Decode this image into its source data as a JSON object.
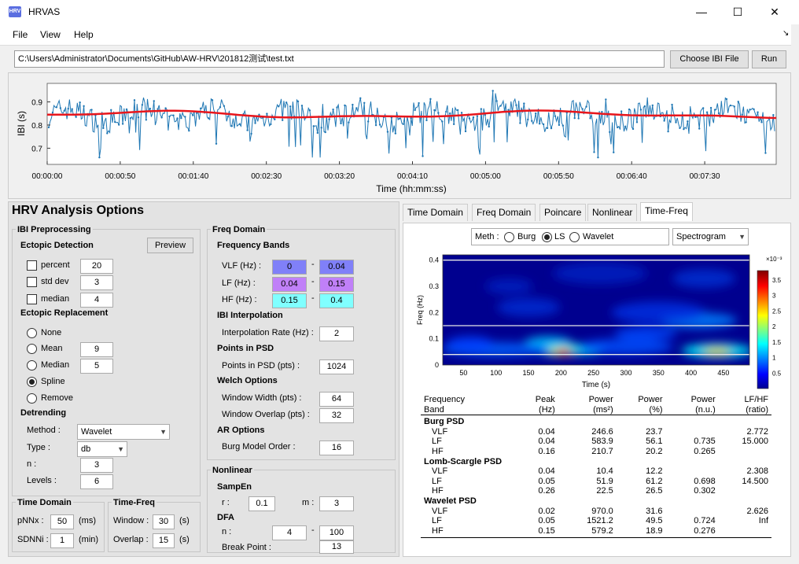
{
  "window": {
    "title": "HRVAS",
    "icon_text": "HRV",
    "minimize": "—",
    "maximize": "☐",
    "close": "✕"
  },
  "menu": {
    "file": "File",
    "view": "View",
    "help": "Help",
    "corner": "↘"
  },
  "file_path": "C:\\Users\\Administrator\\Documents\\GitHub\\AW-HRV\\201812测试\\test.txt",
  "buttons": {
    "choose": "Choose IBI File",
    "run": "Run",
    "preview": "Preview"
  },
  "ibi_plot": {
    "ylabel": "IBI (s)",
    "xlabel": "Time (hh:mm:ss)",
    "yticks": [
      "0.9",
      "0.8",
      "0.7"
    ],
    "xticks": [
      "00:00:00",
      "00:00:50",
      "00:01:40",
      "00:02:30",
      "00:03:20",
      "00:04:10",
      "00:05:00",
      "00:05:50",
      "00:06:40",
      "00:07:30"
    ],
    "colors": {
      "ibi": "#1f77b4",
      "trend": "#e8161c"
    }
  },
  "options": {
    "title": "HRV Analysis Options",
    "ibi_pre": "IBI Preprocessing",
    "ectopic_detection": "Ectopic Detection",
    "percent": {
      "label": "percent",
      "value": "20"
    },
    "stddev": {
      "label": "std dev",
      "value": "3"
    },
    "median": {
      "label": "median",
      "value": "4"
    },
    "ectopic_replacement": "Ectopic Replacement",
    "rep_none": "None",
    "rep_mean": {
      "label": "Mean",
      "value": "9"
    },
    "rep_median": {
      "label": "Median",
      "value": "5"
    },
    "rep_spline": "Spline",
    "rep_remove": "Remove",
    "detrending": "Detrending",
    "method": {
      "label": "Method :",
      "value": "Wavelet"
    },
    "type": {
      "label": "Type :",
      "value": "db"
    },
    "n": {
      "label": "n :",
      "value": "3"
    },
    "levels": {
      "label": "Levels :",
      "value": "6"
    },
    "time_domain": "Time Domain",
    "pnnx": {
      "label": "pNNx :",
      "value": "50",
      "unit": "(ms)"
    },
    "sdnni": {
      "label": "SDNNi :",
      "value": "1",
      "unit": "(min)"
    },
    "time_freq": "Time-Freq",
    "window": {
      "label": "Window :",
      "value": "30",
      "unit": "(s)"
    },
    "overlap": {
      "label": "Overlap :",
      "value": "15",
      "unit": "(s)"
    },
    "freq_domain": "Freq Domain",
    "freq_bands": "Frequency Bands",
    "vlf": {
      "label": "VLF (Hz) :",
      "lo": "0",
      "hi": "0.04"
    },
    "lf": {
      "label": "LF (Hz) :",
      "lo": "0.04",
      "hi": "0.15"
    },
    "hf": {
      "label": "HF (Hz) :",
      "lo": "0.15",
      "hi": "0.4"
    },
    "dash": "-",
    "ibi_interp": "IBI Interpolation",
    "interp_rate": {
      "label": "Interpolation Rate (Hz) :",
      "value": "2"
    },
    "points_psd": "Points in PSD",
    "points_psd_pts": {
      "label": "Points in PSD (pts) :",
      "value": "1024"
    },
    "welch": "Welch Options",
    "window_width": {
      "label": "Window Width (pts) :",
      "value": "64"
    },
    "window_overlap": {
      "label": "Window Overlap (pts) :",
      "value": "32"
    },
    "ar": "AR Options",
    "burg_order": {
      "label": "Burg Model Order :",
      "value": "16"
    },
    "nonlinear": "Nonlinear",
    "sampen": "SampEn",
    "r": {
      "label": "r :",
      "value": "0.1"
    },
    "m": {
      "label": "m :",
      "value": "3"
    },
    "dfa": "DFA",
    "dfa_n": {
      "label": "n :",
      "lo": "4",
      "hi": "100"
    },
    "breakpoint": {
      "label": "Break Point :",
      "value": "13"
    }
  },
  "tabs": [
    "Time Domain",
    "Freq Domain",
    "Poincare",
    "Nonlinear",
    "Time-Freq"
  ],
  "timefreq": {
    "meth_label": "Meth :",
    "methods": [
      "Burg",
      "LS",
      "Wavelet"
    ],
    "selected_method": "LS",
    "display": "Spectrogram",
    "ylabel": "Freq (Hz)",
    "xlabel": "Time (s)",
    "yticks": [
      "0.4",
      "0.3",
      "0.2",
      "0.1",
      "0"
    ],
    "xticks": [
      "50",
      "100",
      "150",
      "200",
      "250",
      "300",
      "350",
      "400",
      "450"
    ],
    "cbar_exp": "×10⁻³",
    "cbar_ticks": [
      "3.5",
      "3",
      "2.5",
      "2",
      "1.5",
      "1",
      "0.5"
    ]
  },
  "results": {
    "headers1": [
      "Frequency",
      "Peak",
      "Power",
      "Power",
      "Power",
      "LF/HF"
    ],
    "headers2": [
      "Band",
      "(Hz)",
      "(ms²)",
      "(%)",
      "(n.u.)",
      "(ratio)"
    ],
    "sections": [
      {
        "name": "Burg PSD",
        "rows": [
          [
            "VLF",
            "0.04",
            "246.6",
            "23.7",
            "",
            "2.772"
          ],
          [
            "LF",
            "0.04",
            "583.9",
            "56.1",
            "0.735",
            "15.000"
          ],
          [
            "HF",
            "0.16",
            "210.7",
            "20.2",
            "0.265",
            ""
          ]
        ]
      },
      {
        "name": "Lomb-Scargle PSD",
        "rows": [
          [
            "VLF",
            "0.04",
            "10.4",
            "12.2",
            "",
            "2.308"
          ],
          [
            "LF",
            "0.05",
            "51.9",
            "61.2",
            "0.698",
            "14.500"
          ],
          [
            "HF",
            "0.26",
            "22.5",
            "26.5",
            "0.302",
            ""
          ]
        ]
      },
      {
        "name": "Wavelet PSD",
        "rows": [
          [
            "VLF",
            "0.02",
            "970.0",
            "31.6",
            "",
            "2.626"
          ],
          [
            "LF",
            "0.05",
            "1521.2",
            "49.5",
            "0.724",
            "Inf"
          ],
          [
            "HF",
            "0.15",
            "579.2",
            "18.9",
            "0.276",
            ""
          ]
        ]
      }
    ]
  }
}
